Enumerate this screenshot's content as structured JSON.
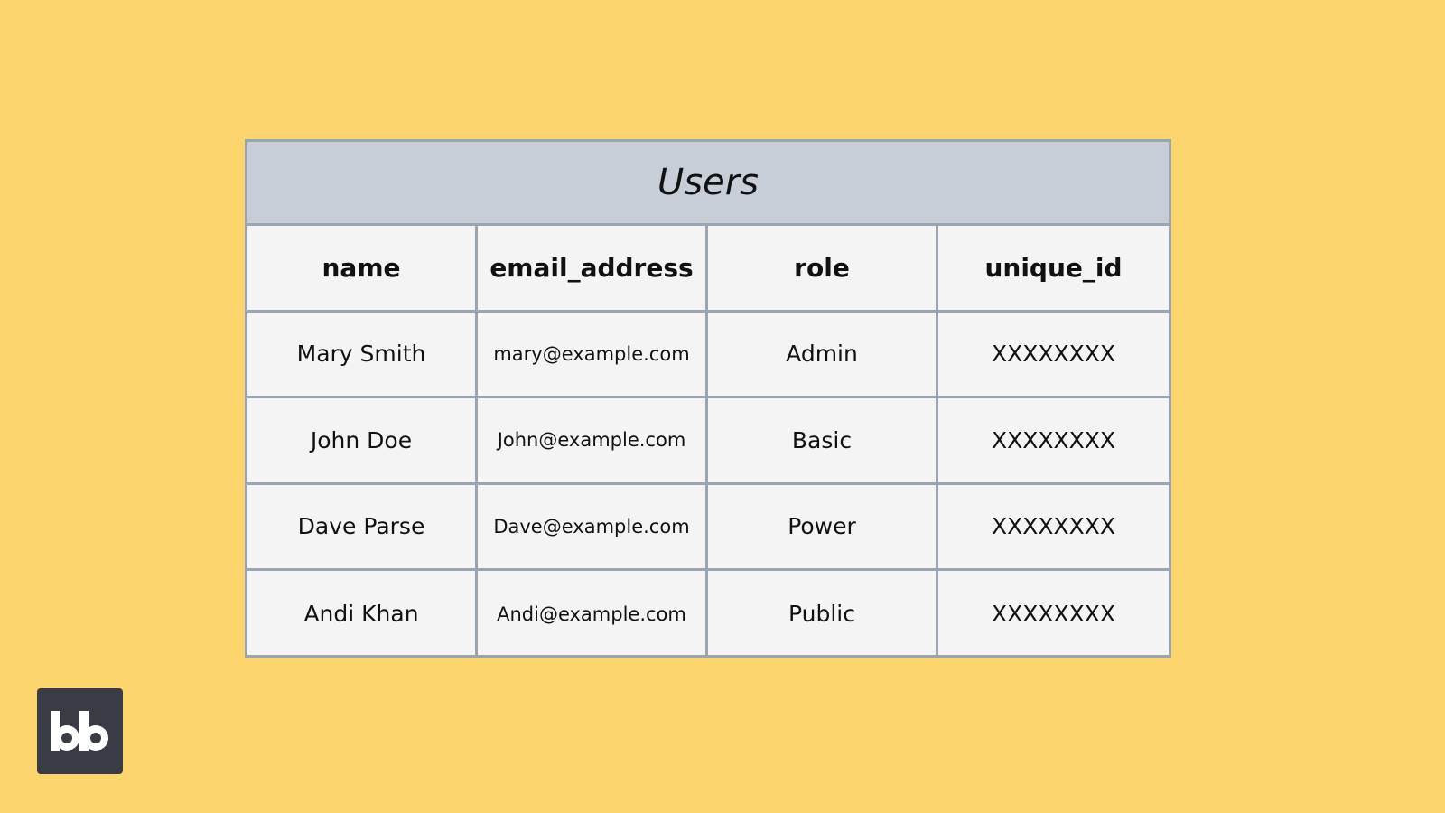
{
  "table": {
    "title": "Users",
    "columns": [
      "name",
      "email_address",
      "role",
      "unique_id"
    ],
    "rows": [
      [
        "Mary Smith",
        "mary@example.com",
        "Admin",
        "XXXXXXXX"
      ],
      [
        "John Doe",
        "John@example.com",
        "Basic",
        "XXXXXXXX"
      ],
      [
        "Dave Parse",
        "Dave@example.com",
        "Power",
        "XXXXXXXX"
      ],
      [
        "Andi Khan",
        "Andi@example.com",
        "Public",
        "XXXXXXXX"
      ]
    ]
  },
  "logo": {
    "icon": "bb-logo-icon",
    "text": "bb"
  },
  "colors": {
    "background": "#fcd56f",
    "title_band": "#c8ced8",
    "cell": "#f4f4f4",
    "border": "#9aa5b1",
    "logo_bg": "#393c45"
  }
}
